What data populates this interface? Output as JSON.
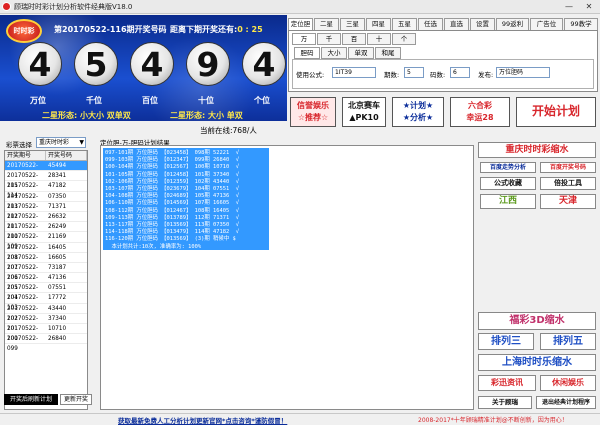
{
  "titlebar": {
    "title": "顾瑞时时彩计划分析软件经典版V18.0",
    "min": "—",
    "close": "✕"
  },
  "header": {
    "logo": "时时彩",
    "period_label": "第20170522-116期开奖号码",
    "next_label": "距离下期开奖还有:",
    "countdown": "0 : 25",
    "balls": [
      "4",
      "5",
      "4",
      "9",
      "4"
    ],
    "positions": [
      "万位",
      "千位",
      "百位",
      "十位",
      "个位"
    ],
    "form1": "二星形态: 小大小 双单双",
    "form2": "二星形态: 大小 单双"
  },
  "tabs": [
    "定位胆",
    "二星",
    "三星",
    "四星",
    "五星",
    "任选",
    "直选",
    "设置",
    "99返利",
    "广告位",
    "99教学"
  ],
  "subtabs": [
    "万",
    "千",
    "百",
    "十",
    "个"
  ],
  "subtabs2": [
    "胆码",
    "大小",
    "单双",
    "和尾"
  ],
  "config": {
    "formula_label": "使用公式:",
    "formula_value": "1IT39",
    "periods_label": "期数:",
    "periods_value": "5",
    "codes_label": "码数:",
    "codes_value": "6",
    "publish_label": "发布:",
    "publish_value": "万位胆码"
  },
  "ads": [
    {
      "line1": "信誉娱乐",
      "line2": "☆推荐☆"
    },
    {
      "line1": "北京赛车",
      "line2": "▲PK10"
    },
    {
      "line1": "★计划★",
      "line2": "★分析★"
    },
    {
      "line1": "六合彩",
      "line2": "幸运28"
    },
    {
      "line1": "开始计划",
      "line2": ""
    }
  ],
  "lottery_select": {
    "label": "彩票选择",
    "value": "重庆时时彩"
  },
  "online": {
    "label": "当前在线:",
    "value": "768/人"
  },
  "result_title": "定位胆-万-胆码计划结果",
  "list": {
    "headers": [
      "开奖期号",
      "开奖号码"
    ],
    "rows": [
      [
        "20170522-116",
        "45494"
      ],
      [
        "20170522-115",
        "28341"
      ],
      [
        "20170522-114",
        "47182"
      ],
      [
        "20170522-113",
        "07350"
      ],
      [
        "20170522-112",
        "71371"
      ],
      [
        "20170522-111",
        "26632"
      ],
      [
        "20170522-110",
        "26249"
      ],
      [
        "20170522-109",
        "21169"
      ],
      [
        "20170522-108",
        "16405"
      ],
      [
        "20170522-107",
        "16605"
      ],
      [
        "20170522-106",
        "73187"
      ],
      [
        "20170522-105",
        "47136"
      ],
      [
        "20170522-104",
        "07551"
      ],
      [
        "20170522-103",
        "17772"
      ],
      [
        "20170522-102",
        "43440"
      ],
      [
        "20170522-101",
        "37340"
      ],
      [
        "20170522-100",
        "10710"
      ],
      [
        "20170522-099",
        "26840"
      ]
    ]
  },
  "results": [
    "097-101期 万位胆码 【023458】 098期 52221  √",
    "099-103期 万位胆码 【012347】 099期 26840  √",
    "100-104期 万位胆码 【012567】 100期 10710  √",
    "101-105期 万位胆码 【012458】 101期 37340  √",
    "102-106期 万位胆码 【012359】 102期 43440  √",
    "103-107期 万位胆码 【023679】 104期 07551  √",
    "104-108期 万位胆码 【024689】 105期 47136  √",
    "106-110期 万位胆码 【014569】 107期 16605  √",
    "108-112期 万位胆码 【012467】 108期 16405  √",
    "109-113期 万位胆码 【013789】 112期 71371  √",
    "113-117期 万位胆码 【013569】 113期 07350  √",
    "114-118期 万位胆码 【013479】 114期 47182  √",
    "116-120期 万位胆码 【013569】 (3)期 稍候中 $",
    "  本计划共计:10次, 准确率为: 100%"
  ],
  "right_buttons": {
    "cq": "重庆时时彩缩水",
    "b1": "百度走势分析",
    "b2": "百度开奖号码",
    "b3": "公式收藏",
    "b4": "倍投工具",
    "b5": "江西",
    "b6": "天津",
    "fc": "福彩3D缩水",
    "p3": "排列三",
    "p5": "排列五",
    "sh": "上海时时乐缩水",
    "cp": "彩迅资讯",
    "xx": "休闲娱乐",
    "about": "关于顾瑞",
    "exit": "退出经典计划程序"
  },
  "bottom": {
    "check_label": "开奖后刷新计划",
    "refresh": "更新开奖",
    "link": "获取最新免费人工分析计划更新官网*点击咨询*谨防假冒！",
    "copyright": "2008-2017*十年顾瑞精准计划@不断创新，因为用心！"
  },
  "colors": {
    "accent": "#0b2d9a",
    "red": "#d8262c",
    "green": "#5c9a1e"
  }
}
